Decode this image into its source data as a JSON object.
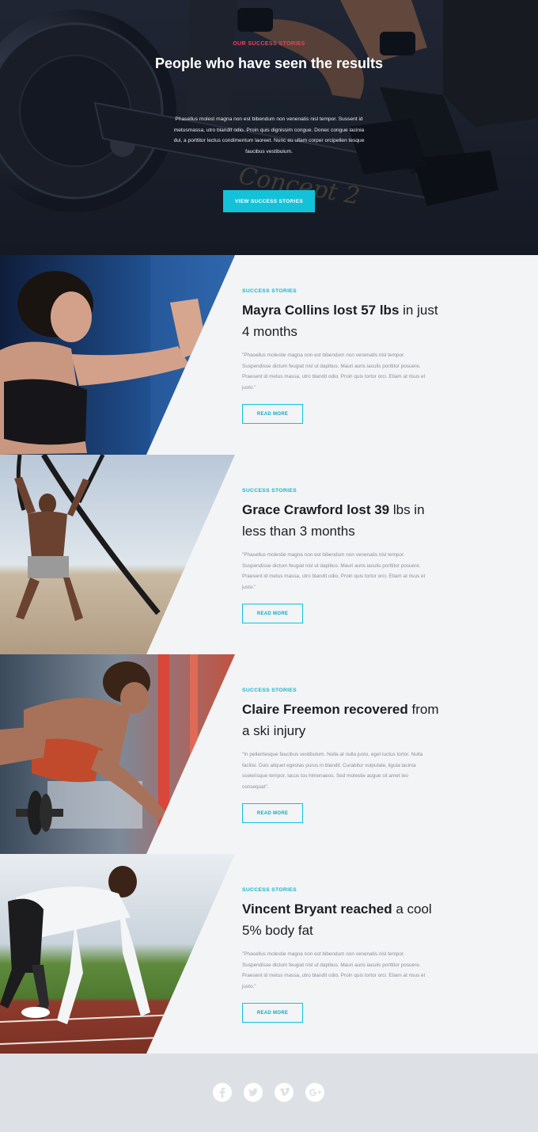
{
  "hero": {
    "kicker": "OUR SUCCESS STORIES",
    "title": "People who have seen the results",
    "text": "Phasellus molest magna non est bibendum non venenatis nisl tempor. Sussent id metusmassa, utro blandit odio. Proin quis dignissim congue. Donec congue lacinia dui, a porttitor lectus condimentum laoreet. Nunc eu ullam corper orcipellen tesque faucibus vestibulum.",
    "button_label": "VIEW SUCCESS STORIES",
    "machine_brand": "Concept 2"
  },
  "stories": [
    {
      "kicker": "SUCCESS STORIES",
      "title_bold": "Mayra Collins lost 57 lbs",
      "title_rest": " in just 4 months",
      "text": "\"Phasellus molestie magna non est bibendum non venenatis nisl tempor. Suspendisse dictum feugiat nisl ut dapibus. Mauri auris iaculis porttitor posuere. Praesent id metus massa, utro blandit odio. Proin quis tortor orci. Etiam at risus et justo.\"",
      "button_label": "READ MORE"
    },
    {
      "kicker": "SUCCESS STORIES",
      "title_bold": "Grace Crawford lost 39",
      "title_rest": " lbs in less than 3 months",
      "text": "\"Phasellus molestie magna non est bibendum non venenatis nisl tempor. Suspendisse dictum feugiat nisl ut dapibus. Mauri auris iaculis porttitor posuere. Praesent id metus massa, utro blandit odio. Proin quis tortor orci. Etiam at risus et justo.\"",
      "button_label": "READ MORE"
    },
    {
      "kicker": "SUCCESS STORIES",
      "title_bold": "Claire Freemon recovered",
      "title_rest": " from a ski injury",
      "text": "\"In pellentesque faucibus vestibulum. Nulla at nulla justo, eget luctus tortor. Nulla facilisi. Duis aliquet egestas purus in blandit. Curabitur vulputate, ligula lacinia scelerisque tempor, lacus tos himenaeos. Sed molestie augue sit amet leo consequat\".",
      "button_label": "READ MORE"
    },
    {
      "kicker": "SUCCESS STORIES",
      "title_bold": "Vincent Bryant reached",
      "title_rest": " a cool 5% body fat",
      "text": "\"Phasellus molestie magna non est bibendum non venenatis nisl tempor. Suspendisse dictum feugiat nisl ut dapibus. Mauri auris iaculis porttitor posuere. Praesent id metus massa, utro blandit odio. Proin quis tortor orci. Etiam at risus et justo.\"",
      "button_label": "READ MORE"
    }
  ],
  "footer": {
    "social": [
      "facebook-icon",
      "twitter-icon",
      "vimeo-icon",
      "google-plus-icon"
    ]
  },
  "colors": {
    "accent": "#13c2d9",
    "kicker_red": "#e8455a",
    "page_bg": "#f2f4f6",
    "footer_bg": "#dde1e5"
  }
}
